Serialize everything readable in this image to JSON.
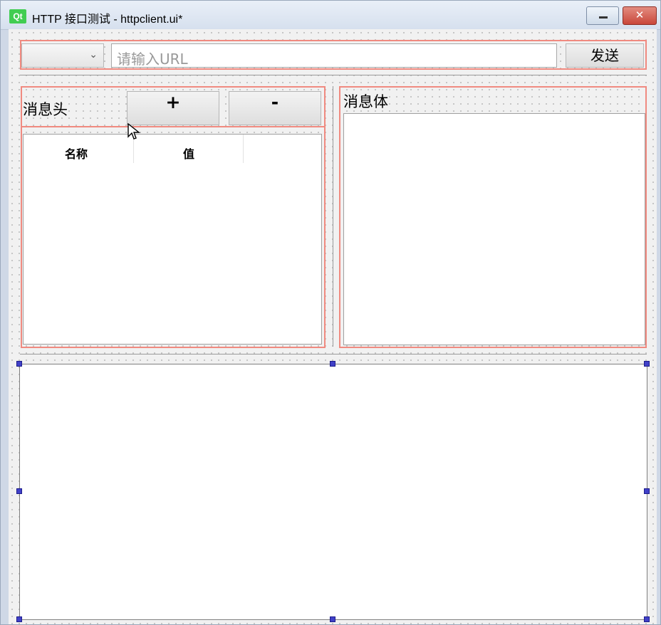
{
  "window": {
    "logo": "Qt",
    "title": "HTTP 接口测试 - httpclient.ui*",
    "minimize_icon": "minimize-icon",
    "close_icon": "close-icon",
    "close_glyph": "✕"
  },
  "request": {
    "method_value": "",
    "url_placeholder": "请输入URL",
    "send_label": "发送"
  },
  "headers": {
    "label": "消息头",
    "add_label": "+",
    "remove_label": "-",
    "columns": [
      "名称",
      "值"
    ]
  },
  "body": {
    "label": "消息体",
    "value": ""
  },
  "response": {
    "value": ""
  },
  "colors": {
    "layout_border": "#f08a80",
    "selection_handle": "#4040c8",
    "qt_logo": "#41cd52"
  }
}
